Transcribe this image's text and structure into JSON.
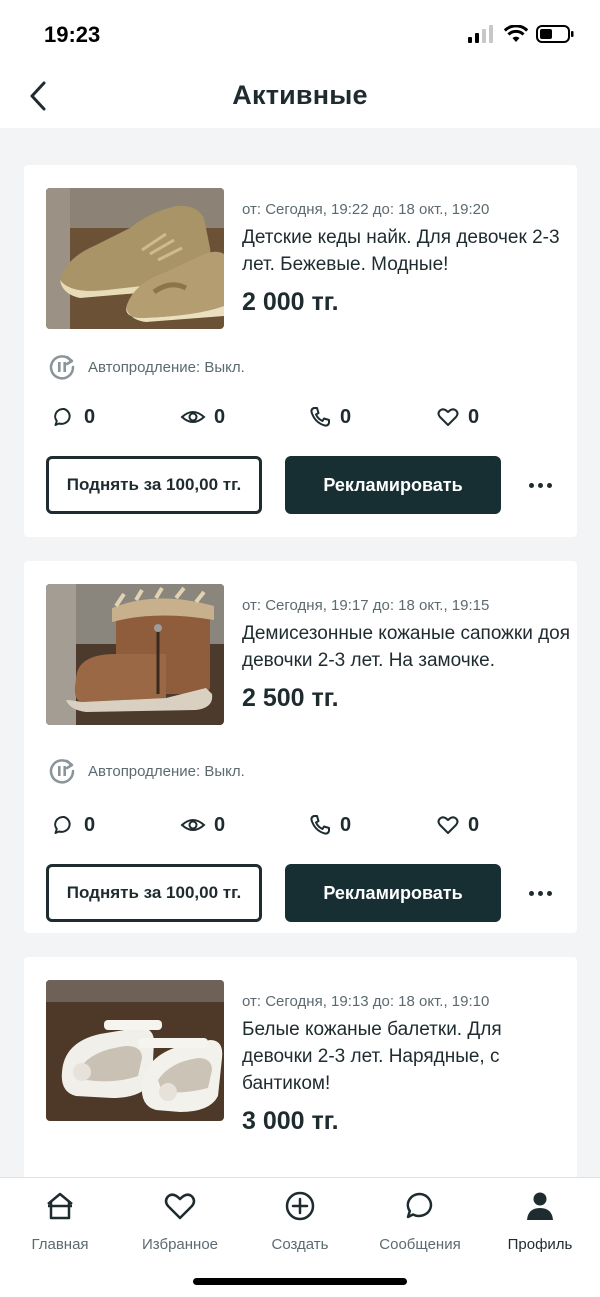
{
  "status_bar": {
    "time": "19:23"
  },
  "header": {
    "title": "Активные"
  },
  "listings": [
    {
      "dates": "от: Сегодня, 19:22 до: 18 окт., 19:20",
      "title": "Детские кеды найк. Для девочек 2-3 лет. Бежевые. Модные!",
      "price": "2 000 тг.",
      "autorenew": "Автопродление: Выкл.",
      "stats": {
        "messages": "0",
        "views": "0",
        "calls": "0",
        "favorites": "0"
      },
      "raise_label": "Поднять за 100,00 тг.",
      "promote_label": "Рекламировать"
    },
    {
      "dates": "от: Сегодня, 19:17 до: 18 окт., 19:15",
      "title": "Демисезонные кожаные сапожки доя девочки 2-3 лет. На замочке.",
      "price": "2 500 тг.",
      "autorenew": "Автопродление: Выкл.",
      "stats": {
        "messages": "0",
        "views": "0",
        "calls": "0",
        "favorites": "0"
      },
      "raise_label": "Поднять за 100,00 тг.",
      "promote_label": "Рекламировать"
    },
    {
      "dates": "от: Сегодня, 19:13 до: 18 окт., 19:10",
      "title": "Белые кожаные балетки. Для девочки 2-3 лет. Нарядные, с бантиком!",
      "price": "3 000 тг."
    }
  ],
  "tabbar": {
    "items": [
      {
        "label": "Главная",
        "icon": "home-icon"
      },
      {
        "label": "Избранное",
        "icon": "heart-icon"
      },
      {
        "label": "Создать",
        "icon": "plus-circle-icon"
      },
      {
        "label": "Сообщения",
        "icon": "chat-icon"
      },
      {
        "label": "Профиль",
        "icon": "profile-icon"
      }
    ],
    "active": "Профиль"
  },
  "colors": {
    "accent": "#172f33",
    "text": "#1e2b2f",
    "muted": "#5c6a70",
    "background": "#f2f4f5"
  }
}
